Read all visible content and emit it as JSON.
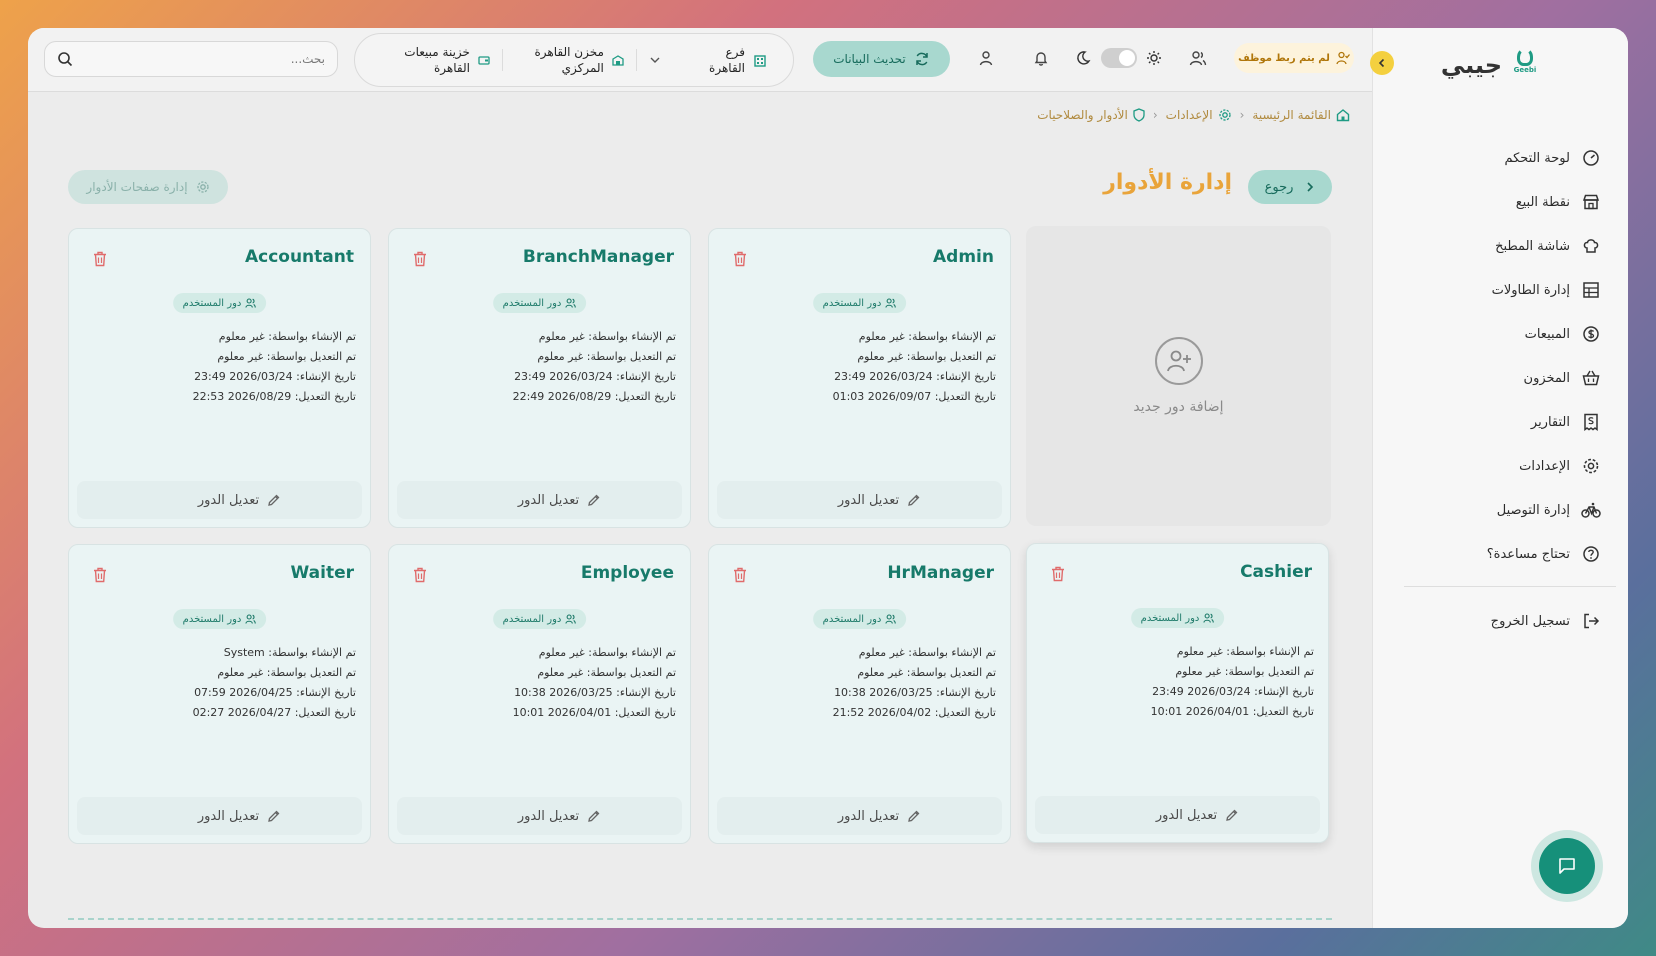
{
  "brand": {
    "name": "جيبي",
    "logo_text": "Geebi"
  },
  "sidebar": {
    "items": [
      {
        "label": "لوحة التحكم",
        "icon": "gauge-icon"
      },
      {
        "label": "نقطة البيع",
        "icon": "store-icon"
      },
      {
        "label": "شاشة المطبخ",
        "icon": "chef-hat-icon"
      },
      {
        "label": "إدارة الطاولات",
        "icon": "table-grid-icon"
      },
      {
        "label": "المبيعات",
        "icon": "dollar-circle-icon"
      },
      {
        "label": "المخزون",
        "icon": "basket-icon"
      },
      {
        "label": "التقارير",
        "icon": "receipt-icon"
      },
      {
        "label": "الإعدادات",
        "icon": "gear-icon"
      },
      {
        "label": "إدارة التوصيل",
        "icon": "bike-icon"
      },
      {
        "label": "تحتاج مساعدة؟",
        "icon": "help-circle-icon"
      }
    ],
    "logout": "تسجيل الخروج"
  },
  "topbar": {
    "search_placeholder": "بحث...",
    "branch": "فرع القاهرة",
    "warehouse": "مخزن القاهرة المركزي",
    "treasury": "خزينة مبيعات القاهرة",
    "refresh": "تحديث البيانات",
    "employee_warning": "لم يتم ربط موظف"
  },
  "breadcrumb": [
    "القائمة الرئيسية",
    "الإعدادات",
    "الأدوار والصلاحيات"
  ],
  "page": {
    "title": "إدارة الأدوار",
    "back": "رجوع",
    "manage_pages": "إدارة صفحات الأدوار",
    "add_role": "إضافة دور جديد"
  },
  "labels": {
    "chip": "دور المستخدم",
    "edit": "تعديل الدور"
  },
  "roles": [
    {
      "name": "Admin",
      "created_by": "تم الإنشاء بواسطة: غير معلوم",
      "updated_by": "تم التعديل بواسطة: غير معلوم",
      "created_at": "تاريخ الإنشاء: 2026/03/24 23:49",
      "updated_at": "تاريخ التعديل: 2026/09/07 01:03"
    },
    {
      "name": "BranchManager",
      "created_by": "تم الإنشاء بواسطة: غير معلوم",
      "updated_by": "تم التعديل بواسطة: غير معلوم",
      "created_at": "تاريخ الإنشاء: 2026/03/24 23:49",
      "updated_at": "تاريخ التعديل: 2026/08/29 22:49"
    },
    {
      "name": "Accountant",
      "created_by": "تم الإنشاء بواسطة: غير معلوم",
      "updated_by": "تم التعديل بواسطة: غير معلوم",
      "created_at": "تاريخ الإنشاء: 2026/03/24 23:49",
      "updated_at": "تاريخ التعديل: 2026/08/29 22:53"
    },
    {
      "name": "Cashier",
      "created_by": "تم الإنشاء بواسطة: غير معلوم",
      "updated_by": "تم التعديل بواسطة: غير معلوم",
      "created_at": "تاريخ الإنشاء: 2026/03/24 23:49",
      "updated_at": "تاريخ التعديل: 2026/04/01 10:01"
    },
    {
      "name": "HrManager",
      "created_by": "تم الإنشاء بواسطة: غير معلوم",
      "updated_by": "تم التعديل بواسطة: غير معلوم",
      "created_at": "تاريخ الإنشاء: 2026/03/25 10:38",
      "updated_at": "تاريخ التعديل: 2026/04/02 21:52"
    },
    {
      "name": "Employee",
      "created_by": "تم الإنشاء بواسطة: غير معلوم",
      "updated_by": "تم التعديل بواسطة: غير معلوم",
      "created_at": "تاريخ الإنشاء: 2026/03/25 10:38",
      "updated_at": "تاريخ التعديل: 2026/04/01 10:01"
    },
    {
      "name": "Waiter",
      "created_by": "تم الإنشاء بواسطة: System",
      "updated_by": "تم التعديل بواسطة: غير معلوم",
      "created_at": "تاريخ الإنشاء: 2026/04/25 07:59",
      "updated_at": "تاريخ التعديل: 2026/04/27 02:27"
    }
  ],
  "colors": {
    "accent": "#177a6a",
    "title": "#e9a43a",
    "delete": "#e06b6b"
  }
}
